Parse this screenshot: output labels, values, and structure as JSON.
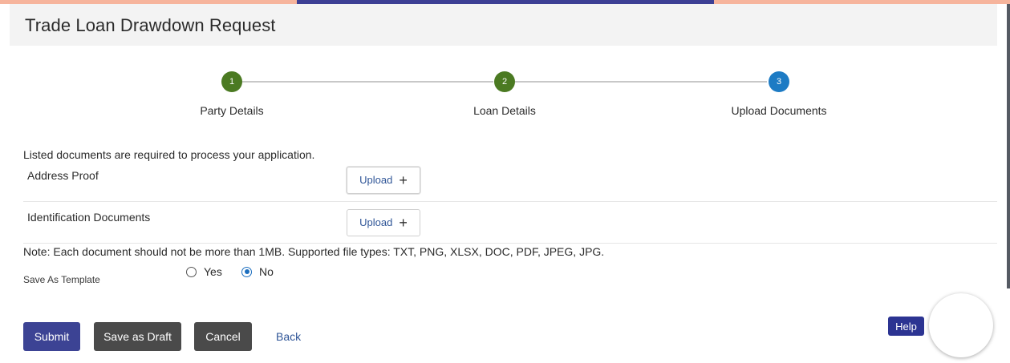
{
  "header": {
    "title": "Trade Loan Drawdown Request"
  },
  "stepper": {
    "steps": [
      {
        "number": "1",
        "label": "Party Details",
        "status": "completed",
        "color": "#4b7a22"
      },
      {
        "number": "2",
        "label": "Loan Details",
        "status": "completed",
        "color": "#4b7a22"
      },
      {
        "number": "3",
        "label": "Upload Documents",
        "status": "current",
        "color": "#1d7bc4"
      }
    ]
  },
  "documents": {
    "intro": "Listed documents are required to process your application.",
    "items": [
      {
        "name": "Address Proof",
        "upload_label": "Upload",
        "upload_icon": "plus-icon"
      },
      {
        "name": "Identification Documents",
        "upload_label": "Upload",
        "upload_icon": "plus-icon"
      }
    ],
    "note": "Note: Each document should not be more than 1MB. Supported file types: TXT, PNG, XLSX, DOC, PDF, JPEG, JPG."
  },
  "template": {
    "label": "Save As Template",
    "options": [
      {
        "label": "Yes",
        "selected": false
      },
      {
        "label": "No",
        "selected": true
      }
    ]
  },
  "actions": {
    "submit": "Submit",
    "save_draft": "Save as Draft",
    "cancel": "Cancel",
    "back": "Back",
    "help": "Help"
  },
  "colors": {
    "primary": "#3c4394",
    "secondary": "#4a4a4a",
    "link": "#2f5597",
    "accent_orange": "#f6b49c"
  }
}
